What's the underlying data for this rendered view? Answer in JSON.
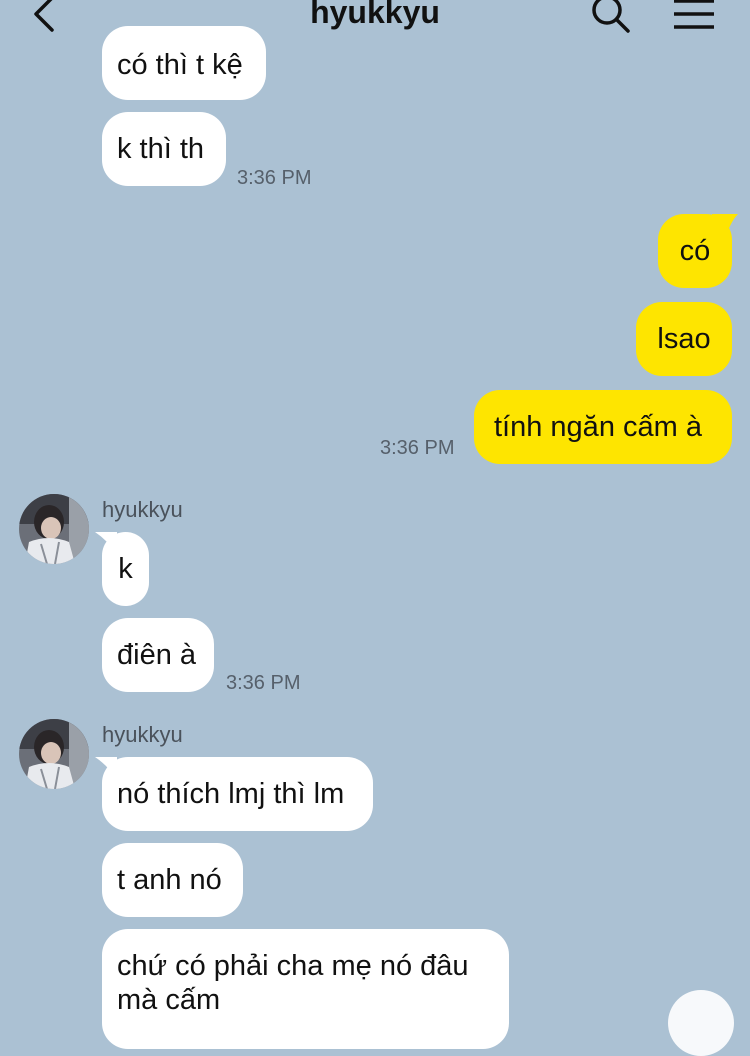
{
  "header": {
    "title": "hyukkyu",
    "back_icon": "chevron-left-icon",
    "search_icon": "search-icon",
    "menu_icon": "menu-icon"
  },
  "colors": {
    "background": "#abc1d3",
    "incoming_bubble": "#ffffff",
    "outgoing_bubble": "#fee500"
  },
  "messages": {
    "m1": "có thì t kệ",
    "m2": "k thì th",
    "t1": "3:36 PM",
    "m3": "có",
    "m4": "lsao",
    "m5": "tính ngăn cấm à",
    "t2": "3:36 PM",
    "sender1": "hyukkyu",
    "m6": "k",
    "m7": "điên à",
    "t3": "3:36 PM",
    "sender2": "hyukkyu",
    "m8": "nó thích lmj thì lm",
    "m9": "t anh nó",
    "m10_line1": "chứ có phải cha mẹ nó đâu",
    "m10_line2": "mà cấm"
  }
}
